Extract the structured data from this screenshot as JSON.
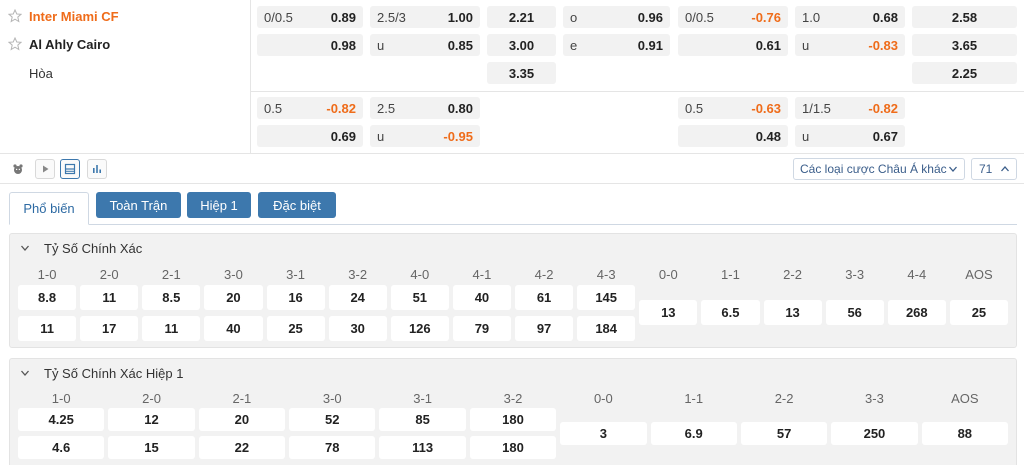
{
  "match": {
    "home": "Inter Miami CF",
    "away": "Al Ahly Cairo",
    "draw": "Hòa"
  },
  "top_odds": {
    "row1": [
      {
        "hc": "0/0.5",
        "od": "0.89",
        "neg": false
      },
      {
        "hc": "2.5/3",
        "od": "1.00",
        "neg": false
      },
      {
        "mid": "2.21"
      },
      {
        "hc": "o",
        "od": "0.96",
        "neg": false
      },
      {
        "hc": "0/0.5",
        "od": "-0.76",
        "neg": true
      },
      {
        "hc": "1.0",
        "od": "0.68",
        "neg": false
      },
      {
        "mid": "2.58"
      }
    ],
    "row2": [
      {
        "hc": "",
        "od": "0.98",
        "neg": false
      },
      {
        "hc": "u",
        "od": "0.85",
        "neg": false
      },
      {
        "mid": "3.00"
      },
      {
        "hc": "e",
        "od": "0.91",
        "neg": false
      },
      {
        "hc": "",
        "od": "0.61",
        "neg": false
      },
      {
        "hc": "u",
        "od": "-0.83",
        "neg": true
      },
      {
        "mid": "3.65"
      }
    ],
    "row3": [
      {
        "mid": "3.35"
      },
      {
        "mid": "2.25"
      }
    ],
    "row4": [
      {
        "hc": "0.5",
        "od": "-0.82",
        "neg": true
      },
      {
        "hc": "2.5",
        "od": "0.80",
        "neg": false
      },
      {
        "hc": "0.5",
        "od": "-0.63",
        "neg": true
      },
      {
        "hc": "1/1.5",
        "od": "-0.82",
        "neg": true
      }
    ],
    "row5": [
      {
        "hc": "",
        "od": "0.69",
        "neg": false
      },
      {
        "hc": "u",
        "od": "-0.95",
        "neg": true
      },
      {
        "hc": "",
        "od": "0.48",
        "neg": false
      },
      {
        "hc": "u",
        "od": "0.67",
        "neg": false
      }
    ]
  },
  "toolbar": {
    "icons": [
      "bear-icon",
      "play-icon",
      "layout-icon",
      "stats-icon"
    ],
    "select_label": "Các loại cược Châu Á khác",
    "count": "71"
  },
  "tabs": [
    "Phổ biến",
    "Toàn Trận",
    "Hiệp 1",
    "Đặc biệt"
  ],
  "panels": [
    {
      "title": "Tỷ Số Chính Xác",
      "stack_headers": [
        "1-0",
        "2-0",
        "2-1",
        "3-0",
        "3-1",
        "3-2",
        "4-0",
        "4-1",
        "4-2",
        "4-3"
      ],
      "stack_row1": [
        "8.8",
        "11",
        "8.5",
        "20",
        "16",
        "24",
        "51",
        "40",
        "61",
        "145"
      ],
      "stack_row2": [
        "11",
        "17",
        "11",
        "40",
        "25",
        "30",
        "126",
        "79",
        "97",
        "184"
      ],
      "single_headers": [
        "0-0",
        "1-1",
        "2-2",
        "3-3",
        "4-4",
        "AOS"
      ],
      "single_values": [
        "13",
        "6.5",
        "13",
        "56",
        "268",
        "25"
      ]
    },
    {
      "title": "Tỷ Số Chính Xác Hiệp 1",
      "stack_headers": [
        "1-0",
        "2-0",
        "2-1",
        "3-0",
        "3-1",
        "3-2"
      ],
      "stack_row1": [
        "4.25",
        "12",
        "20",
        "52",
        "85",
        "180"
      ],
      "stack_row2": [
        "4.6",
        "15",
        "22",
        "78",
        "113",
        "180"
      ],
      "single_headers": [
        "0-0",
        "1-1",
        "2-2",
        "3-3",
        "AOS"
      ],
      "single_values": [
        "3",
        "6.9",
        "57",
        "250",
        "88"
      ]
    }
  ],
  "colors": {
    "accent_orange": "#ef6c1a",
    "tab_blue": "#3d78ad",
    "link_blue": "#2d6aa3"
  }
}
